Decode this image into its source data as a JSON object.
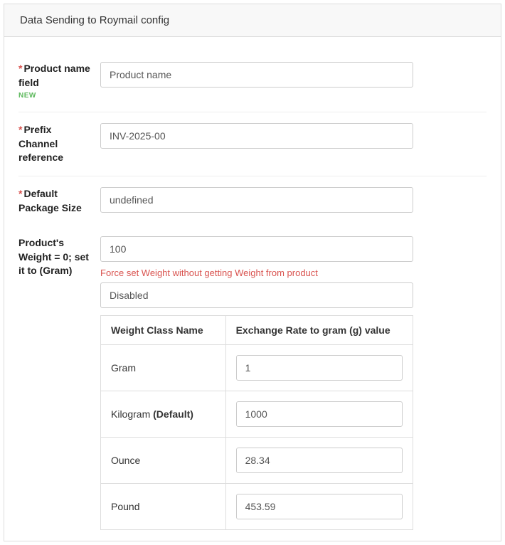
{
  "panel": {
    "title": "Data Sending to Roymail config"
  },
  "fields": {
    "productName": {
      "label": "Product name field",
      "badge": "NEW",
      "value": "Product name"
    },
    "prefixChannel": {
      "label": "Prefix Channel reference",
      "value": "INV-2025-00"
    },
    "packageSize": {
      "label": "Default Package Size",
      "value": "undefined"
    },
    "weight": {
      "label": "Product's Weight = 0; set it to (Gram)",
      "value": "100",
      "help": "Force set Weight without getting Weight from product",
      "disabledValue": "Disabled"
    }
  },
  "table": {
    "headers": {
      "name": "Weight Class Name",
      "rate": "Exchange Rate to gram (g) value"
    },
    "rows": [
      {
        "name": "Gram",
        "default": false,
        "rate": "1"
      },
      {
        "name": "Kilogram",
        "default": true,
        "rate": "1000"
      },
      {
        "name": "Ounce",
        "default": false,
        "rate": "28.34"
      },
      {
        "name": "Pound",
        "default": false,
        "rate": "453.59"
      }
    ],
    "defaultSuffix": " (Default)"
  }
}
